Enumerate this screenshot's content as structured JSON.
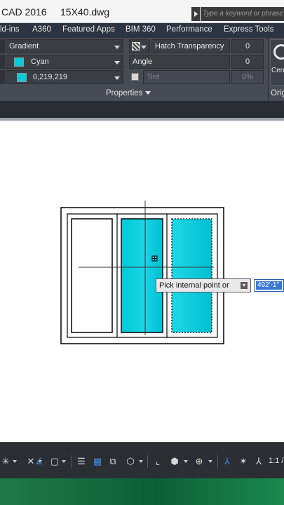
{
  "titlebar": {
    "app_title": "CAD 2016",
    "file_name": "15X40.dwg",
    "search_placeholder": "Type a keyword or phrase"
  },
  "ribbon_tabs": [
    "ld-ins",
    "A360",
    "Featured Apps",
    "BIM 360",
    "Performance",
    "Express Tools"
  ],
  "properties_panel": {
    "hatch_type": "Gradient",
    "color_1": "Cyan",
    "color_2": "0,219,219",
    "hatch_transparency_label": "Hatch Transparency",
    "hatch_transparency_value": "0",
    "angle_label": "Angle",
    "angle_value": "0",
    "tint_label": "Tint",
    "tint_value": "0%",
    "panel_title": "Properties",
    "accent_color": "#00ccdb"
  },
  "origin_panel": {
    "button_label": "Cen",
    "panel_title": "Orig"
  },
  "drawing": {
    "hatch_color": "#00ccdb",
    "prompt_text": "Pick internal point or",
    "coordinate_input": "492'-1\""
  },
  "statusbar": {
    "scale": "1:1 /"
  }
}
